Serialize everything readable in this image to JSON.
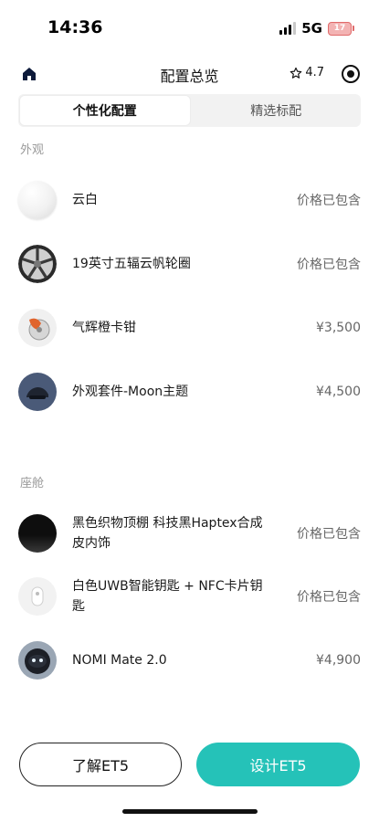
{
  "status_bar": {
    "time": "14:36",
    "network": "5G",
    "battery": "17"
  },
  "nav": {
    "title": "配置总览",
    "rating": "4.7",
    "home_icon": "home-icon",
    "settings_icon": "target-icon"
  },
  "tabs": [
    {
      "label": "个性化配置",
      "active": true
    },
    {
      "label": "精选标配",
      "active": false
    }
  ],
  "sections": {
    "exterior": {
      "title": "外观",
      "items": [
        {
          "name": "云白",
          "price": "价格已包含",
          "icon": "white-paint-swatch"
        },
        {
          "name": "19英寸五辐云帆轮圈",
          "price": "价格已包含",
          "icon": "wheel-rim"
        },
        {
          "name": "气辉橙卡钳",
          "price": "¥3,500",
          "icon": "orange-caliper"
        },
        {
          "name": "外观套件-Moon主题",
          "price": "¥4,500",
          "icon": "moon-theme-kit"
        }
      ]
    },
    "cabin": {
      "title": "座舱",
      "items": [
        {
          "name": "黑色织物顶棚 科技黑Haptex合成皮内饰",
          "price": "价格已包含",
          "icon": "black-interior-swatch"
        },
        {
          "name": "白色UWB智能钥匙 + NFC卡片钥匙",
          "price": "价格已包含",
          "icon": "smart-key"
        },
        {
          "name": "NOMI Mate 2.0",
          "price": "¥4,900",
          "icon": "nomi-mate"
        }
      ]
    }
  },
  "buttons": {
    "learn": "了解ET5",
    "design": "设计ET5"
  },
  "colors": {
    "accent": "#25c2b8"
  }
}
